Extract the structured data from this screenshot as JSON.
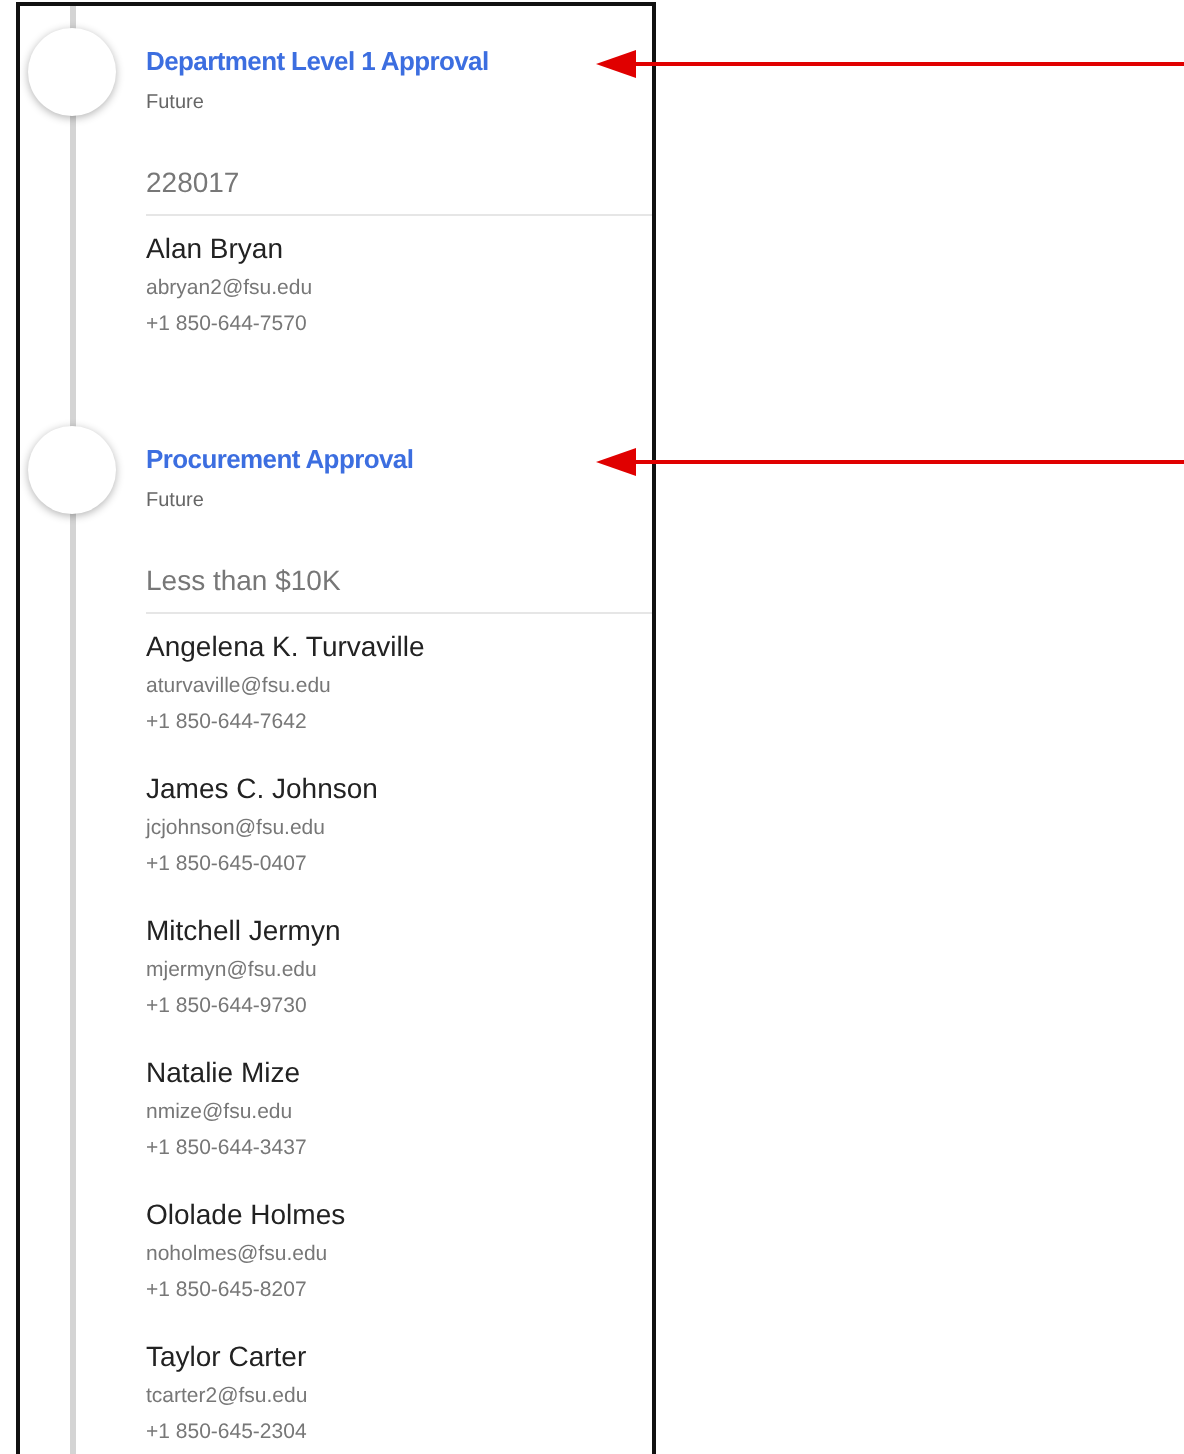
{
  "steps": [
    {
      "title": "Department Level 1 Approval",
      "status": "Future",
      "annotated": true,
      "group": "228017",
      "people": [
        {
          "name": "Alan Bryan",
          "email": "abryan2@fsu.edu",
          "phone": "+1 850-644-7570"
        }
      ]
    },
    {
      "title": "Procurement Approval",
      "status": "Future",
      "annotated": true,
      "group": "Less than $10K",
      "people": [
        {
          "name": "Angelena K. Turvaville",
          "email": "aturvaville@fsu.edu",
          "phone": "+1 850-644-7642"
        },
        {
          "name": "James C. Johnson",
          "email": "jcjohnson@fsu.edu",
          "phone": "+1 850-645-0407"
        },
        {
          "name": "Mitchell Jermyn",
          "email": "mjermyn@fsu.edu",
          "phone": "+1 850-644-9730"
        },
        {
          "name": "Natalie Mize",
          "email": "nmize@fsu.edu",
          "phone": "+1 850-644-3437"
        },
        {
          "name": "Ololade Holmes",
          "email": "noholmes@fsu.edu",
          "phone": "+1 850-645-8207"
        },
        {
          "name": "Taylor Carter",
          "email": "tcarter2@fsu.edu",
          "phone": "+1 850-645-2304"
        }
      ]
    }
  ]
}
